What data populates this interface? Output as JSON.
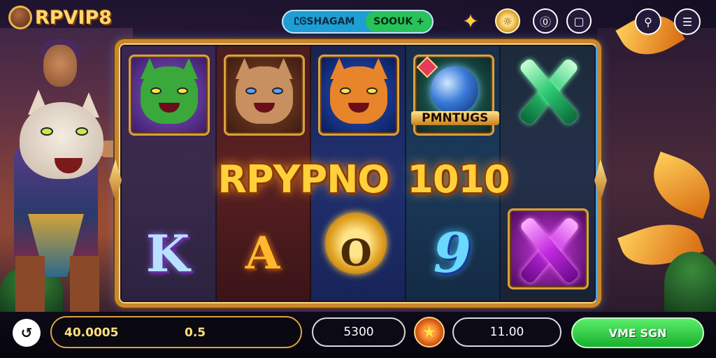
{
  "header": {
    "logo_text": "RPVIP8",
    "account_pill": {
      "left_label": "ᏝᎶSHAGAM",
      "right_label": "SOOUK +"
    },
    "icons": [
      "star-icon",
      "coin-icon",
      "info-icon",
      "chat-icon",
      "profile-icon",
      "menu-icon"
    ]
  },
  "reels": {
    "top_row": [
      "green-cat-symbol",
      "armored-cat-symbol",
      "lion-symbol",
      "orb-symbol",
      "green-x-symbol"
    ],
    "orb_label": "PMNTUGS",
    "banner_word": "RPYPNO",
    "banner_number": "1010",
    "bottom_row_letters": {
      "k": "K",
      "a": "A",
      "o": "O",
      "nine": "9"
    }
  },
  "footer": {
    "balance": "40.0005",
    "bet": "0.5",
    "field_left": "5300",
    "field_right": "11.00",
    "spin_label": "VME SGN"
  },
  "colors": {
    "gold": "#ffd03a",
    "spin_green": "#18b02e",
    "pill_blue": "#1e9fd4",
    "pill_green": "#27c25a",
    "frame_blue_glow": "#4aa8e8"
  }
}
